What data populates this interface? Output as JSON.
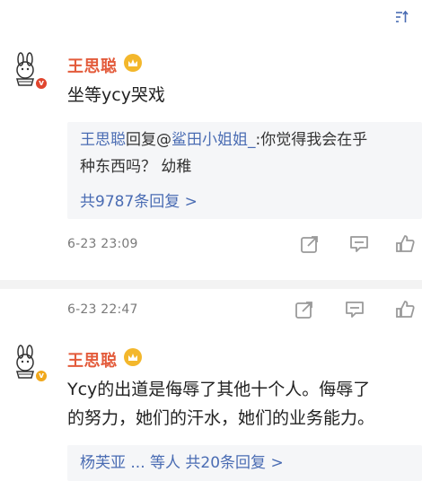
{
  "top_bar": {
    "sort_icon": "sort-icon"
  },
  "comments": [
    {
      "username": "王思聪",
      "avatar_icon": "cartoon-rabbit-avatar",
      "verified_icon": "verified-red-badge",
      "badge_icon": "crown-badge",
      "text": "坐等ycy哭戏",
      "reply": {
        "author": "王思聪",
        "prefix": "回复@",
        "target": "鲨田小姐姐_",
        "content_line1": ":你觉得我会在乎",
        "content_line2": "种东西吗？ 幼稚",
        "count_label": "共9787条回复 >"
      },
      "timestamp": "6-23 23:09",
      "actions": [
        "share-icon",
        "comment-icon",
        "like-icon"
      ]
    },
    {
      "username": "王思聪",
      "avatar_icon": "cartoon-rabbit-avatar",
      "verified_icon": "verified-gold-badge",
      "badge_icon": "crown-badge",
      "timestamp": "6-23 22:47",
      "text_line1": "Ycy的出道是侮辱了其他十个人。侮辱了",
      "text_line2": "的努力，她们的汗水，她们的业务能力。",
      "reply_preview": "杨芙亚 ... 等人 共20条回复 >",
      "actions": [
        "share-icon",
        "comment-icon",
        "like-icon"
      ]
    }
  ],
  "colors": {
    "name": "#e35b3b",
    "link": "#4a6cb3",
    "meta": "#7a7a7a",
    "icon": "#9a9a9a",
    "badge": "#f3b72c",
    "verified_red": "#e0452e",
    "verified_gold": "#f0a81c"
  }
}
